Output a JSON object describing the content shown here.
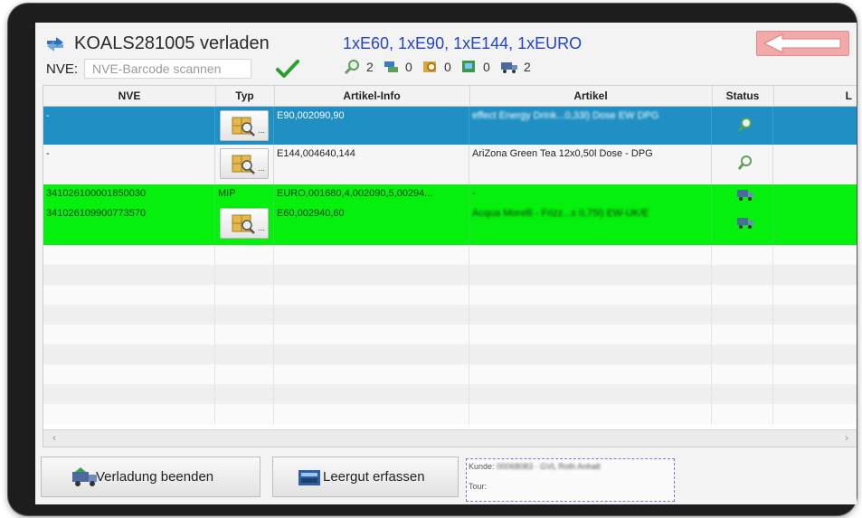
{
  "header": {
    "title": "KOALS281005 verladen",
    "summary": "1xE60, 1xE90, 1xE144, 1xEURO",
    "nve_label": "NVE:",
    "nve_placeholder": "NVE-Barcode scannen",
    "counts": [
      {
        "icon": "magnifier-icon",
        "value": "2"
      },
      {
        "icon": "pallet-stack-icon",
        "value": "0"
      },
      {
        "icon": "search-box-icon",
        "value": "0"
      },
      {
        "icon": "loaded-box-icon",
        "value": "0"
      },
      {
        "icon": "truck-icon",
        "value": "2"
      }
    ]
  },
  "table": {
    "columns": [
      "NVE",
      "Typ",
      "Artikel-Info",
      "Artikel",
      "Status",
      "L"
    ],
    "rows": [
      {
        "nve": "-",
        "typ": "",
        "artikel_info": "E90,002090,90",
        "artikel": "effect Energy Drink...0,33l) Dose EW DPG",
        "status": "magnifier-icon",
        "state": "selected"
      },
      {
        "nve": "-",
        "typ": "",
        "artikel_info": "E144,004640,144",
        "artikel": "AriZona Green Tea 12x0,50l Dose - DPG",
        "status": "magnifier-icon",
        "state": "normal"
      },
      {
        "nve": "341026100001850030",
        "typ": "MIP",
        "artikel_info": "EURO,001680,4,002090,5,00294...",
        "artikel": "-",
        "status": "truck-icon",
        "state": "loaded"
      },
      {
        "nve": "341026109900773570",
        "typ": "",
        "artikel_info": "E60,002940,60",
        "artikel": "Acqua Morelli - Frizz...x 0,75l) EW-UK/E",
        "status": "truck-icon",
        "state": "loaded"
      }
    ]
  },
  "footer": {
    "finish_label": "Verladung beenden",
    "empties_label": "Leergut erfassen",
    "customer_label": "Kunde:",
    "customer_value": "00068083 · GVL Roth Anhalt",
    "tour_label": "Tour:"
  },
  "colors": {
    "selected_row": "#1f8fc4",
    "loaded_row": "#05f00c",
    "summary_text": "#2244cc",
    "back_button": "#f1a9a9"
  }
}
